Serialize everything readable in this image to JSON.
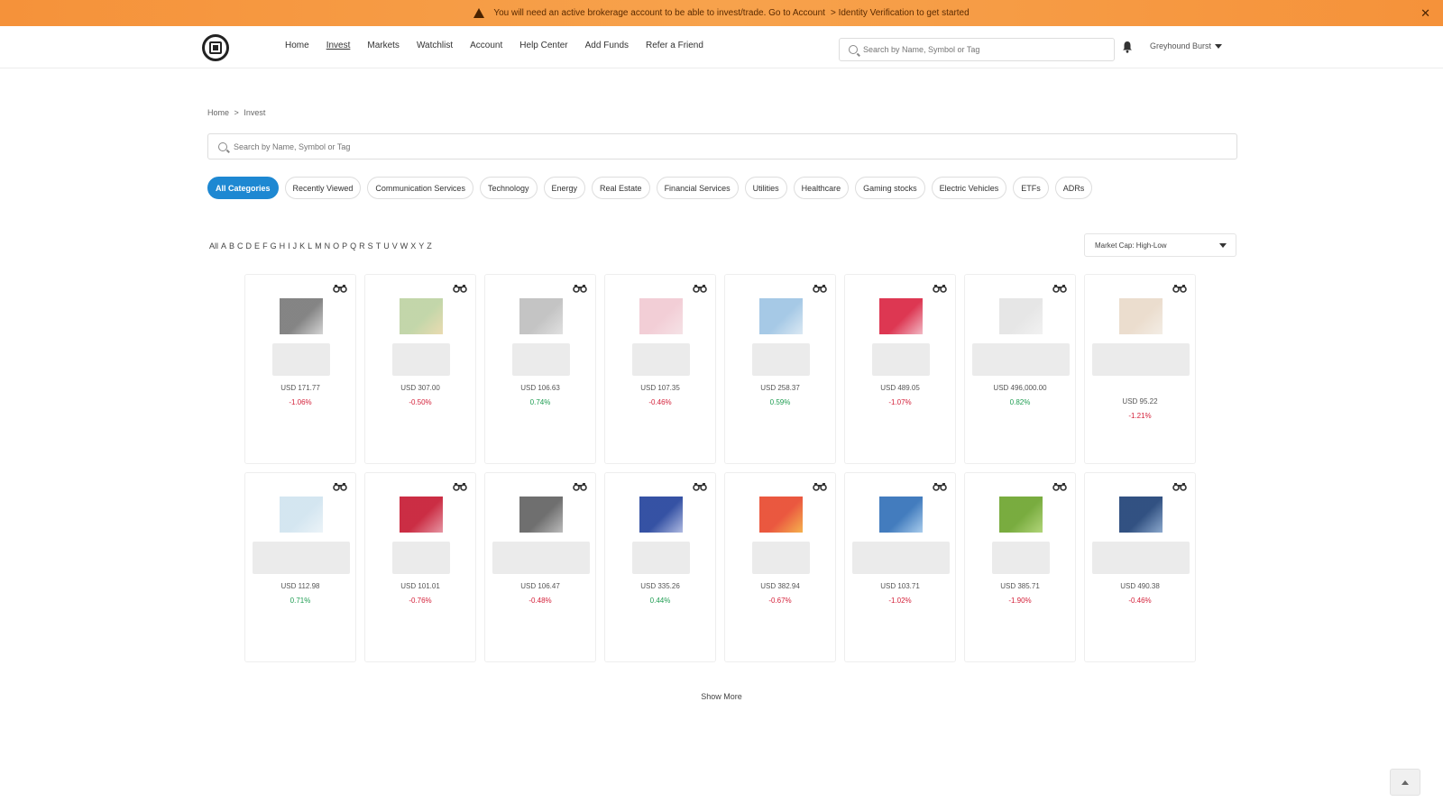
{
  "banner": {
    "text": "You will need an active brokerage account to be able to invest/trade. Go to Account",
    "link": "> Identity Verification to get started",
    "close_icon": "close-icon"
  },
  "header": {
    "nav": [
      {
        "label": "Home",
        "active": false
      },
      {
        "label": "Invest",
        "active": true
      },
      {
        "label": "Markets",
        "active": false
      },
      {
        "label": "Watchlist",
        "active": false
      },
      {
        "label": "Account",
        "active": false
      },
      {
        "label": "Help Center",
        "active": false
      },
      {
        "label": "Add Funds",
        "active": false
      },
      {
        "label": "Refer a Friend",
        "active": false
      }
    ],
    "search_placeholder": "Search by Name, Symbol or Tag",
    "user_name": "Greyhound Burst"
  },
  "breadcrumb": {
    "home": "Home",
    "separator": ">",
    "current": "Invest"
  },
  "main_search_placeholder": "Search by Name, Symbol or Tag",
  "categories": [
    "All Categories",
    "Recently Viewed",
    "Communication Services",
    "Technology",
    "Energy",
    "Real Estate",
    "Financial Services",
    "Utilities",
    "Healthcare",
    "Gaming stocks",
    "Electric Vehicles",
    "ETFs",
    "ADRs"
  ],
  "alphabet": [
    "All",
    "A",
    "B",
    "C",
    "D",
    "E",
    "F",
    "G",
    "H",
    "I",
    "J",
    "K",
    "L",
    "M",
    "N",
    "O",
    "P",
    "Q",
    "R",
    "S",
    "T",
    "U",
    "V",
    "W",
    "X",
    "Y",
    "Z"
  ],
  "sort": {
    "selected": "Market Cap: High-Low"
  },
  "cards": [
    {
      "price": "USD 171.77",
      "change": "-1.06%",
      "dir": "neg",
      "logo": [
        "#777777",
        "#cfcfcf"
      ]
    },
    {
      "price": "USD 307.00",
      "change": "-0.50%",
      "dir": "neg",
      "logo": [
        "#bcd2a0",
        "#e8d7a8"
      ]
    },
    {
      "price": "USD 106.63",
      "change": "0.74%",
      "dir": "pos",
      "logo": [
        "#bdbdbd",
        "#dddddd"
      ]
    },
    {
      "price": "USD 107.35",
      "change": "-0.46%",
      "dir": "neg",
      "logo": [
        "#f1c9d2",
        "#f4dfe3"
      ]
    },
    {
      "price": "USD 258.37",
      "change": "0.59%",
      "dir": "pos",
      "logo": [
        "#9cc3e3",
        "#d7e6f2"
      ]
    },
    {
      "price": "USD 489.05",
      "change": "-1.07%",
      "dir": "neg",
      "logo": [
        "#d9213f",
        "#f0b0bd"
      ]
    },
    {
      "price": "USD 496,000.00",
      "change": "0.82%",
      "dir": "pos",
      "logo": [
        "#e3e3e3",
        "#f0f0f0"
      ]
    },
    {
      "price": "USD 95.22",
      "change": "-1.21%",
      "dir": "neg",
      "logo": [
        "#e9d9c8",
        "#f2ebe2"
      ]
    },
    {
      "price": "USD 112.98",
      "change": "0.71%",
      "dir": "pos",
      "logo": [
        "#cfe3ef",
        "#e9f2f7"
      ]
    },
    {
      "price": "USD 101.01",
      "change": "-0.76%",
      "dir": "neg",
      "logo": [
        "#c5162f",
        "#e38a99"
      ]
    },
    {
      "price": "USD 106.47",
      "change": "-0.48%",
      "dir": "neg",
      "logo": [
        "#5f5f5f",
        "#b4b4b4"
      ]
    },
    {
      "price": "USD 335.26",
      "change": "0.44%",
      "dir": "pos",
      "logo": [
        "#1f3f9a",
        "#a6b2de"
      ]
    },
    {
      "price": "USD 382.94",
      "change": "-0.67%",
      "dir": "neg",
      "logo": [
        "#e8452a",
        "#f4a93a"
      ]
    },
    {
      "price": "USD 103.71",
      "change": "-1.02%",
      "dir": "neg",
      "logo": [
        "#2e6eb7",
        "#9fc7ea"
      ]
    },
    {
      "price": "USD 385.71",
      "change": "-1.90%",
      "dir": "neg",
      "logo": [
        "#6aa32a",
        "#a9d06b"
      ]
    },
    {
      "price": "USD 490.38",
      "change": "-0.46%",
      "dir": "neg",
      "logo": [
        "#1b3e74",
        "#7f9fc8"
      ]
    }
  ],
  "show_more": "Show More"
}
